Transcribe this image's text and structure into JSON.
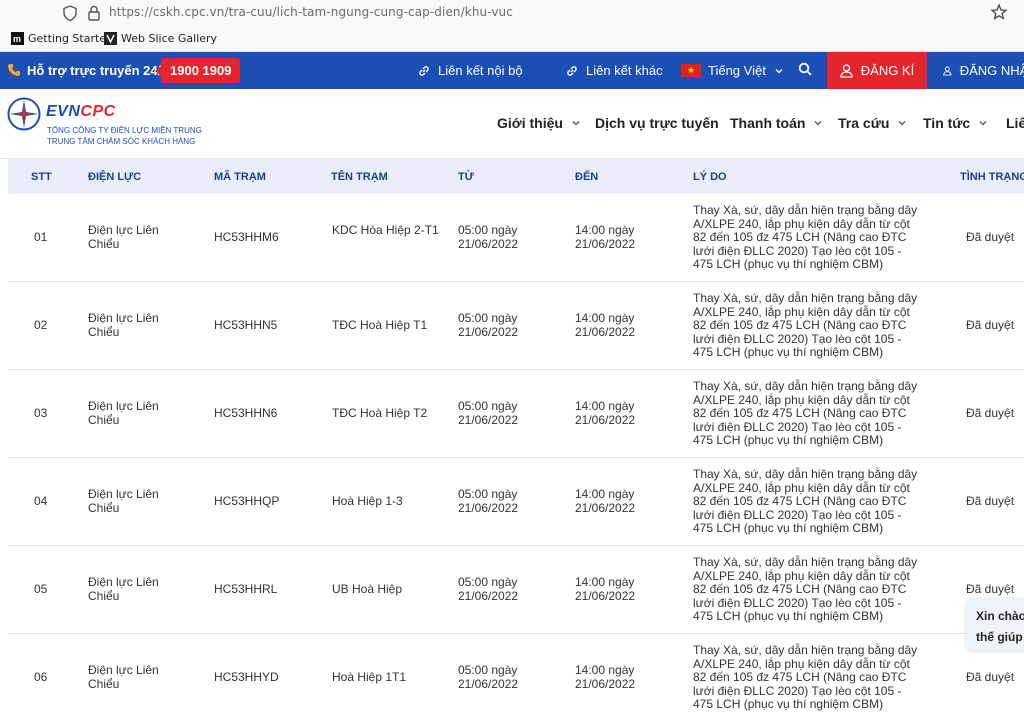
{
  "browser": {
    "url": "https://cskh.cpc.vn/tra-cuu/lich-tam-ngung-cung-cap-dien/khu-vuc",
    "bookmarks": [
      {
        "label": "Getting Started",
        "icon": "mdn-icon"
      },
      {
        "label": "Web Slice Gallery",
        "icon": "web-slice-icon"
      }
    ]
  },
  "topbar": {
    "hotline_label": "Hỗ trợ trực truyến 24/7:",
    "hotline_number": "1900 1909",
    "internal_link": "Liên kết nội bộ",
    "other_link": "Liên kết khác",
    "language": "Tiếng Việt",
    "register": "ĐĂNG KÍ",
    "login": "ĐĂNG NHẬP",
    "colors": {
      "blue": "#1b4fb5",
      "red": "#e3262e"
    }
  },
  "header": {
    "logo_evn": "EVN",
    "logo_cpc": "CPC",
    "logo_line1": "TỔNG CÔNG TY ĐIỆN LỰC MIỀN TRUNG",
    "logo_line2": "TRUNG TÂM CHĂM SÓC KHÁCH HÀNG",
    "nav": [
      "Giới thiệu",
      "Dịch vụ trực tuyến",
      "Thanh toán",
      "Tra cứu",
      "Tin tức",
      "Liên"
    ]
  },
  "table": {
    "headers": [
      "STT",
      "ĐIỆN LỰC",
      "MÃ TRẠM",
      "TÊN TRẠM",
      "TỪ",
      "ĐẾN",
      "LÝ DO",
      "TÌNH TRẠNG"
    ],
    "rows": [
      {
        "stt": "01",
        "dien_luc": "Điện lực Liên Chiểu",
        "ma_tram": "HC53HHM6",
        "ten_tram": "KDC Hòa Hiệp 2-T1",
        "tu": "05:00 ngày 21/06/2022",
        "den": "14:00 ngày 21/06/2022",
        "ly_do": "Thay Xà, sứ, dây dẫn hiện trạng bằng dây A/XLPE 240, lắp phụ kiện dây dẫn từ cột 82 đến 105 đz 475 LCH (Nâng cao ĐTC lưới điện ĐLLC 2020) Tạo lèo cột 105 - 475 LCH (phục vụ thí nghiệm CBM)",
        "tinh_trang": "Đã duyệt"
      },
      {
        "stt": "02",
        "dien_luc": "Điện lực Liên Chiểu",
        "ma_tram": "HC53HHN5",
        "ten_tram": "TĐC Hoà Hiệp T1",
        "tu": "05:00 ngày 21/06/2022",
        "den": "14:00 ngày 21/06/2022",
        "ly_do": "Thay Xà, sứ, dây dẫn hiện trạng bằng dây A/XLPE 240, lắp phụ kiện dây dẫn từ cột 82 đến 105 đz 475 LCH (Nâng cao ĐTC lưới điện ĐLLC 2020) Tạo lèo cột 105 - 475 LCH (phục vụ thí nghiệm CBM)",
        "tinh_trang": "Đã duyệt"
      },
      {
        "stt": "03",
        "dien_luc": "Điện lực Liên Chiểu",
        "ma_tram": "HC53HHN6",
        "ten_tram": "TĐC Hoà Hiệp T2",
        "tu": "05:00 ngày 21/06/2022",
        "den": "14:00 ngày 21/06/2022",
        "ly_do": "Thay Xà, sứ, dây dẫn hiện trạng bằng dây A/XLPE 240, lắp phụ kiện dây dẫn từ cột 82 đến 105 đz 475 LCH (Nâng cao ĐTC lưới điện ĐLLC 2020) Tạo lèo cột 105 - 475 LCH (phục vụ thí nghiệm CBM)",
        "tinh_trang": "Đã duyệt"
      },
      {
        "stt": "04",
        "dien_luc": "Điện lực Liên Chiểu",
        "ma_tram": "HC53HHQP",
        "ten_tram": "Hoà Hiệp 1-3",
        "tu": "05:00 ngày 21/06/2022",
        "den": "14:00 ngày 21/06/2022",
        "ly_do": "Thay Xà, sứ, dây dẫn hiện trạng bằng dây A/XLPE 240, lắp phụ kiện dây dẫn từ cột 82 đến 105 đz 475 LCH (Nâng cao ĐTC lưới điện ĐLLC 2020) Tạo lèo cột 105 - 475 LCH (phục vụ thí nghiệm CBM)",
        "tinh_trang": "Đã duyệt"
      },
      {
        "stt": "05",
        "dien_luc": "Điện lực Liên Chiểu",
        "ma_tram": "HC53HHRL",
        "ten_tram": "UB Hoà Hiệp",
        "tu": "05:00 ngày 21/06/2022",
        "den": "14:00 ngày 21/06/2022",
        "ly_do": "Thay Xà, sứ, dây dẫn hiện trạng bằng dây A/XLPE 240, lắp phụ kiện dây dẫn từ cột 82 đến 105 đz 475 LCH (Nâng cao ĐTC lưới điện ĐLLC 2020) Tạo lèo cột 105 - 475 LCH (phục vụ thí nghiệm CBM)",
        "tinh_trang": "Đã duyệt"
      },
      {
        "stt": "06",
        "dien_luc": "Điện lực Liên Chiểu",
        "ma_tram": "HC53HHYD",
        "ten_tram": "Hoà Hiệp 1T1",
        "tu": "05:00 ngày 21/06/2022",
        "den": "14:00 ngày 21/06/2022",
        "ly_do": "Thay Xà, sứ, dây dẫn hiện trạng bằng dây A/XLPE 240, lắp phụ kiện dây dẫn từ cột 82 đến 105 đz 475 LCH (Nâng cao ĐTC lưới điện ĐLLC 2020) Tạo lèo cột 105 - 475 LCH (phục vụ thí nghiệm CBM)",
        "tinh_trang": "Đã duyệt"
      }
    ]
  },
  "chat": {
    "line1": "Xin chào",
    "line2": "thế giúp c"
  }
}
